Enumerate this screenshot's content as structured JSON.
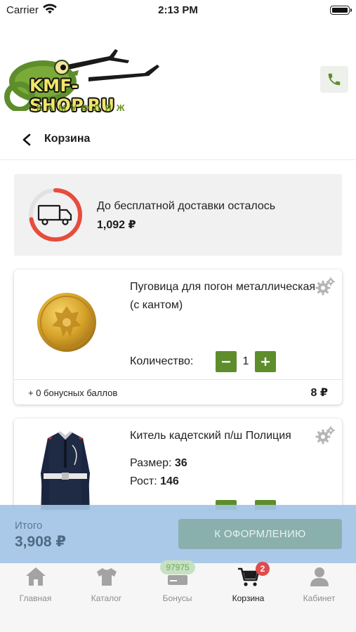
{
  "status": {
    "carrier": "Carrier",
    "time": "2:13 PM"
  },
  "header": {
    "logo_text": "KMF-SHOP.RU",
    "logo_sub": "КАМУФЛЯЖ"
  },
  "page": {
    "title": "Корзина"
  },
  "delivery": {
    "label": "До бесплатной доставки осталось",
    "amount": "1,092 ₽",
    "progress_fraction": 0.72
  },
  "items": [
    {
      "name": "Пуговица для погон металлическая (с кантом)",
      "qty_label": "Количество:",
      "qty": "1",
      "bonus": "+ 0 бонусных баллов",
      "price": "8 ₽"
    },
    {
      "name": "Китель кадетский п/ш Полиция",
      "size_label": "Размер:",
      "size": "36",
      "height_label": "Рост:",
      "height": "146"
    }
  ],
  "summary": {
    "total_label": "Итого",
    "total": "3,908 ₽",
    "checkout": "К ОФОРМЛЕНИЮ"
  },
  "tabs": [
    {
      "label": "Главная",
      "icon": "home-icon"
    },
    {
      "label": "Каталог",
      "icon": "tshirt-icon"
    },
    {
      "label": "Бонусы",
      "icon": "bonus-card-icon",
      "badge": "97975"
    },
    {
      "label": "Корзина",
      "icon": "cart-icon",
      "badge": "2",
      "active": true
    },
    {
      "label": "Кабинет",
      "icon": "user-icon"
    }
  ],
  "colors": {
    "accent_green": "#5e8d2b",
    "progress_red": "#e74c3c",
    "badge_red": "#e04b4b",
    "total_bar": "#a3c4e6",
    "checkout_bg": "#8ab0ae"
  }
}
